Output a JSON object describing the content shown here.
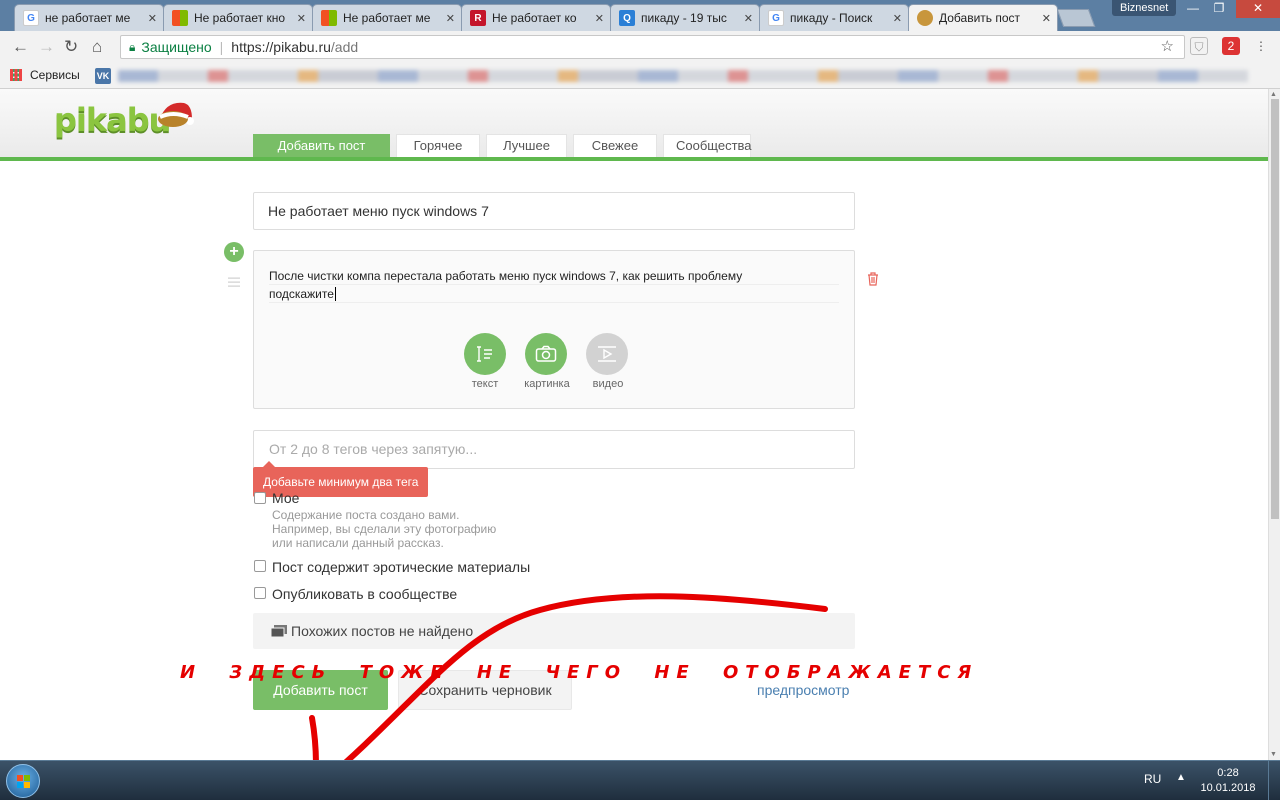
{
  "browser": {
    "tabs": [
      {
        "title": "не работает ме",
        "favicon": "google-icon"
      },
      {
        "title": "Не работает кно",
        "favicon": "microsoft-icon"
      },
      {
        "title": "Не работает ме",
        "favicon": "microsoft-icon"
      },
      {
        "title": "Не работает ко",
        "favicon": "r-icon"
      },
      {
        "title": "пикаду - 19 тыс",
        "favicon": "search-icon"
      },
      {
        "title": "пикаду - Поиск",
        "favicon": "google-icon"
      },
      {
        "title": "Добавить пост",
        "favicon": "pikabu-icon",
        "active": true
      }
    ],
    "window_user": "Biznesnet",
    "address": {
      "secure_label": "Защищено",
      "url_host": "https://pikabu.ru",
      "url_path": "/add"
    },
    "extension_badge": "2",
    "bookmarks": {
      "apps_label": "Сервисы",
      "vk_label": "VK"
    }
  },
  "site": {
    "logo": "pikabu",
    "nav": [
      "Добавить пост",
      "Горячее",
      "Лучшее",
      "Свежее",
      "Сообщества"
    ],
    "active_nav_index": 0
  },
  "form": {
    "title_value": "Не работает меню пуск windows 7",
    "body_line1": "После чистки компа перестала работать меню пуск windows 7, как решить проблему",
    "body_line2": "подскажите",
    "add_buttons": [
      {
        "label": "текст",
        "icon": "text-icon",
        "state": "active"
      },
      {
        "label": "картинка",
        "icon": "camera-icon",
        "state": "active"
      },
      {
        "label": "видео",
        "icon": "video-icon",
        "state": "disabled"
      }
    ],
    "tags_placeholder": "От 2 до 8 тегов через запятую...",
    "tags_error": "Добавьте минимум два тега",
    "mine_label": "Мое",
    "mine_help": [
      "Содержание поста создано вами.",
      "Например, вы сделали эту фотографию",
      "или написали данный рассказ."
    ],
    "erotic_label": "Пост содержит эротические материалы",
    "community_label": "Опубликовать в сообществе",
    "similar_text": "Похожих постов не найдено",
    "submit_label": "Добавить пост",
    "draft_label": "Сохранить черновик",
    "preview_label": "предпросмотр"
  },
  "annotation": {
    "text": "И ЗДЕСЬ ТОЖЕ НЕ ЧЕГО НЕ ОТОБРАЖАЕТСЯ",
    "color": "#e50000"
  },
  "taskbar": {
    "lang": "RU",
    "time": "0:28",
    "date": "10.01.2018"
  },
  "colors": {
    "accent": "#79be67",
    "error": "#e8645a",
    "link": "#4a7fb0"
  }
}
